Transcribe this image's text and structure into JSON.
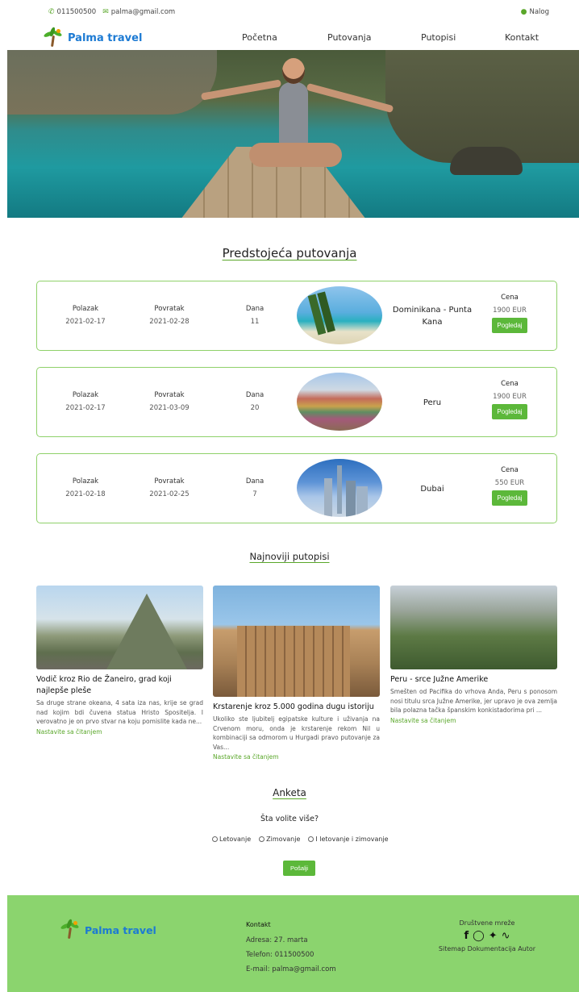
{
  "topbar": {
    "phone": "011500500",
    "email": "palma@gmail.com",
    "account": "Nalog"
  },
  "brand": {
    "name": "Palma travel"
  },
  "nav": {
    "items": [
      "Početna",
      "Putovanja",
      "Putopisi",
      "Kontakt"
    ]
  },
  "upcoming": {
    "title": "Predstojeća putovanja",
    "labels": {
      "departure": "Polazak",
      "return": "Povratak",
      "days": "Dana",
      "price": "Cena",
      "view": "Pogledaj"
    },
    "trips": [
      {
        "departure": "2021-02-17",
        "return": "2021-02-28",
        "days": "11",
        "destination": "Dominikana - Punta Kana",
        "price": "1900 EUR"
      },
      {
        "departure": "2021-02-17",
        "return": "2021-03-09",
        "days": "20",
        "destination": "Peru",
        "price": "1900 EUR"
      },
      {
        "departure": "2021-02-18",
        "return": "2021-02-25",
        "days": "7",
        "destination": "Dubai",
        "price": "550 EUR"
      }
    ]
  },
  "blogs": {
    "title": "Najnoviji putopisi",
    "read_more": "Nastavite sa čitanjem",
    "items": [
      {
        "title": "Vodič kroz Rio de Žaneiro, grad koji najlepše pleše",
        "excerpt": "Sa druge strane okeana, 4 sata iza nas, krije se grad nad kojim bdi čuvena statua Hristo Spositelja. I verovatno je on prvo stvar na koju pomislite kada ne..."
      },
      {
        "title": "Krstarenje kroz 5.000 godina dugu istoriju",
        "excerpt": "Ukoliko ste ljubitelj egipatske kulture i uživanja na Crvenom moru, onda je krstarenje rekom Nil u kombinaciji sa odmorom u Hurgadi pravo putovanje za Vas..."
      },
      {
        "title": "Peru - srce Južne Amerike",
        "excerpt": "Smešten od Pacifika do vrhova Anda, Peru s ponosom nosi titulu srca Južne Amerike, jer upravo je ova zemlja bila polazna tačka španskim konkistadorima pri ..."
      }
    ]
  },
  "poll": {
    "title": "Anketa",
    "question": "Šta volite više?",
    "options": [
      "Letovanje",
      "Zimovanje",
      "I letovanje i zimovanje"
    ],
    "submit": "Pošalji"
  },
  "footer": {
    "brand": "Palma travel",
    "contact_title": "Kontakt",
    "address": "Adresa: 27. marta",
    "phone": "Telefon: 011500500",
    "email": "E-mail: palma@gmail.com",
    "social_title": "Društvene mreže",
    "links": "Sitemap Dokumentacija Autor"
  },
  "colors": {
    "accent": "#5cb83a",
    "brand": "#1c7ad3",
    "footer_bg": "#8bd46e",
    "card_border": "#8fd16a"
  }
}
